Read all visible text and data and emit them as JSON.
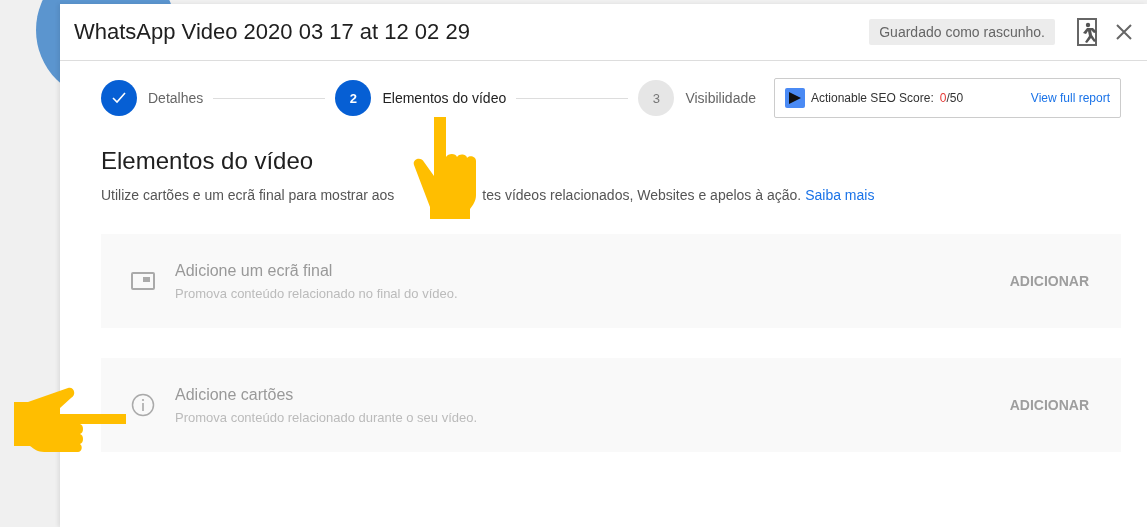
{
  "dialog": {
    "title": "WhatsApp Video 2020 03 17 at 12 02 29",
    "saved_status": "Guardado como rascunho."
  },
  "steps": [
    {
      "kind": "done",
      "label": "Detalhes",
      "selected": false
    },
    {
      "kind": "number",
      "number": "2",
      "label": "Elementos do vídeo",
      "selected": true
    },
    {
      "kind": "number",
      "number": "3",
      "label": "Visibilidade",
      "selected": false
    }
  ],
  "seo": {
    "label": "Actionable SEO Score:",
    "score": "0",
    "total": "/50",
    "link": "View full report"
  },
  "section": {
    "heading": "Elementos do vídeo",
    "description_before": "Utilize cartões e um ecrã final para mostrar aos",
    "description_after": "tes vídeos relacionados, Websites e apelos à ação.",
    "link": "Saiba mais"
  },
  "cards": [
    {
      "kind": "end_screen",
      "title": "Adicione um ecrã final",
      "subtitle": "Promova conteúdo relacionado no final do vídeo.",
      "action": "ADICIONAR",
      "disabled": true
    },
    {
      "kind": "cards",
      "title": "Adicione cartões",
      "subtitle": "Promova conteúdo relacionado durante o seu vídeo.",
      "action": "ADICIONAR",
      "disabled": true
    }
  ]
}
